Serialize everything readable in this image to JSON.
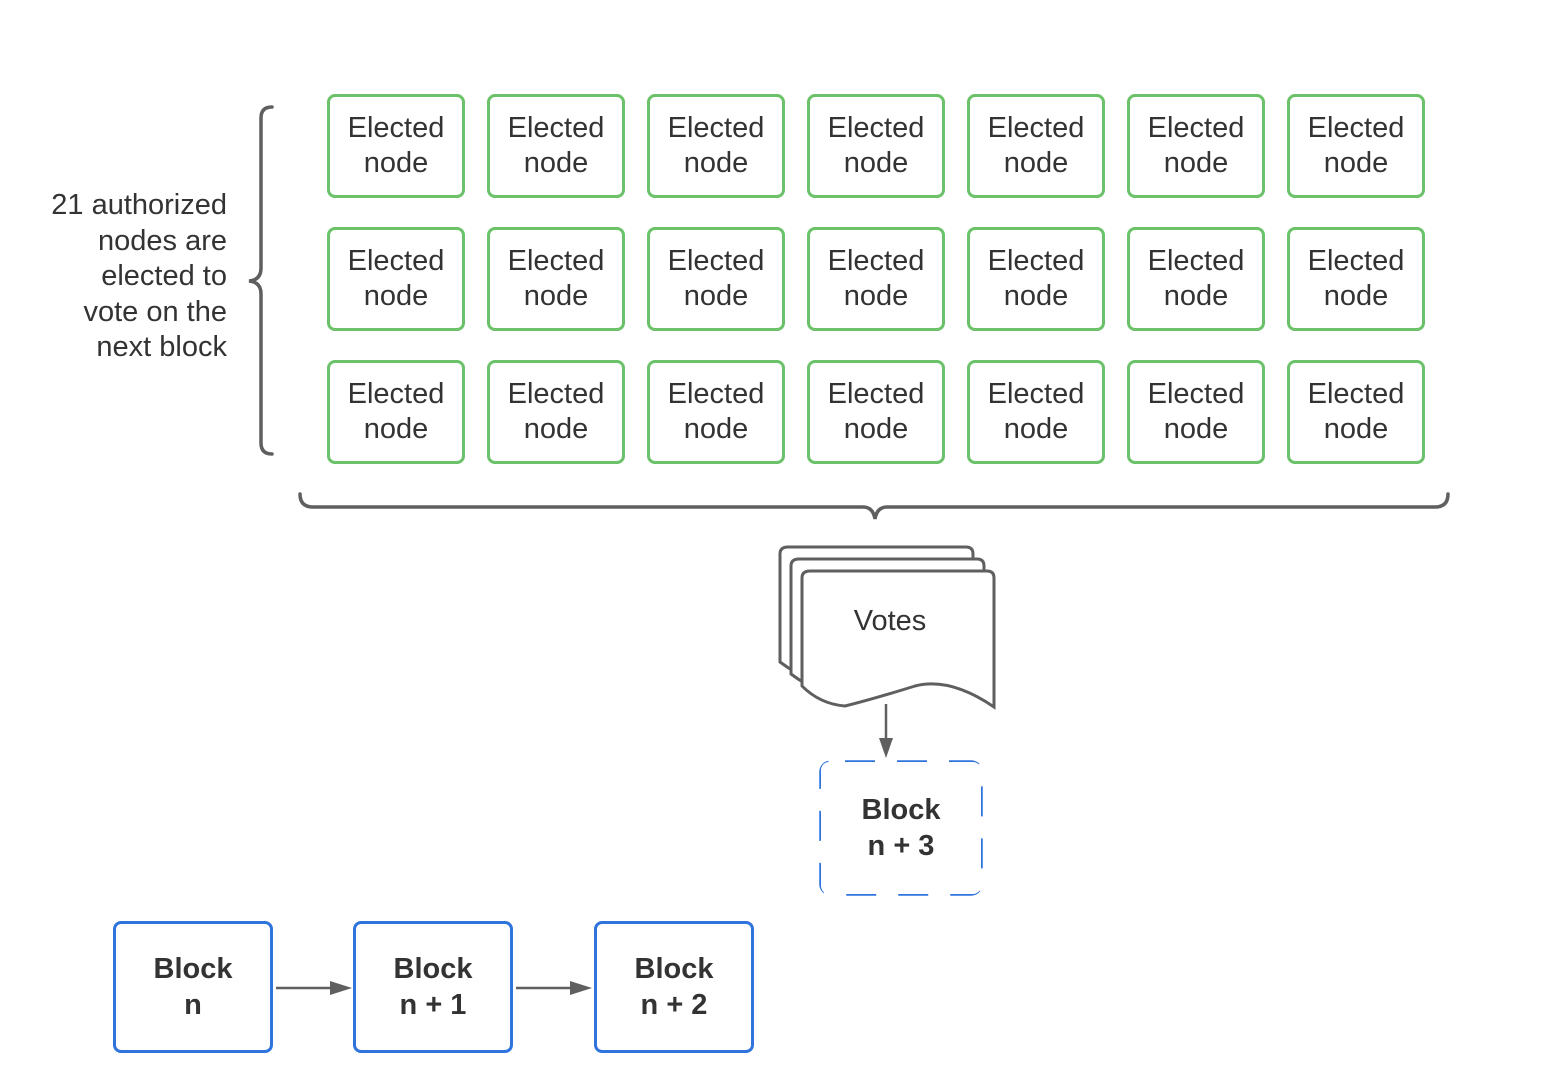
{
  "caption": {
    "lines": [
      "21 authorized",
      "nodes are",
      "elected to",
      "vote on the",
      "next block"
    ]
  },
  "elected_nodes": {
    "rows": 3,
    "columns": 7,
    "count": 21,
    "line1": "Elected",
    "line2": "node",
    "border_color": "#6cc26a"
  },
  "votes": {
    "label": "Votes"
  },
  "pending_block": {
    "line1": "Block",
    "line2": "n + 3",
    "style": "dashed",
    "border_color": "#2f74dd"
  },
  "chain": {
    "blocks": [
      {
        "line1": "Block",
        "line2": "n"
      },
      {
        "line1": "Block",
        "line2": "n + 1"
      },
      {
        "line1": "Block",
        "line2": "n + 2"
      }
    ],
    "border_color": "#2f74dd"
  },
  "colors": {
    "connector": "#5f5f5f",
    "text": "#333333"
  }
}
